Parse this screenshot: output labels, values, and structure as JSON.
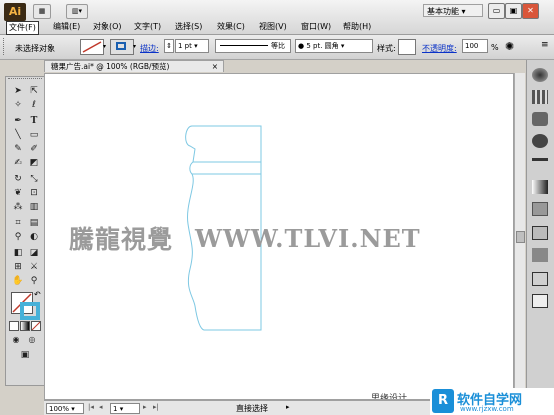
{
  "app": {
    "logo": "Ai",
    "workspace": "基本功能"
  },
  "window_controls": {
    "minimize": "▭",
    "restore": "▣",
    "close": "✕"
  },
  "menu": [
    "文件(F)",
    "编辑(E)",
    "对象(O)",
    "文字(T)",
    "选择(S)",
    "效果(C)",
    "视图(V)",
    "窗口(W)",
    "帮助(H)"
  ],
  "control_bar": {
    "selection_label": "未选择对象",
    "stroke_label": "描边:",
    "stroke_weight": "1 pt",
    "profile_label": "等比",
    "brush_label": "5 pt. 圆角",
    "style_label": "样式:",
    "opacity_label": "不透明度:",
    "opacity_value": "100",
    "opacity_unit": "%"
  },
  "document_tab": {
    "title": "糖果广告.ai* @ 100% (RGB/预览)",
    "close": "×"
  },
  "status_bar": {
    "zoom": "100%",
    "page": "1",
    "tool": "直接选择"
  },
  "watermarks": {
    "main_cn": "騰龍視覺",
    "main_en": "WWW.TLVI.NET",
    "corner_text": "思缘设计",
    "site_name": "软件自学网",
    "site_url": "www.rjzxw.com"
  },
  "colors": {
    "stroke_path": "#7ec8e3",
    "accent_stroke_swatch": "#c0392b",
    "tool_stroke_cyan": "#46b1d8"
  },
  "icons": {
    "tools": [
      "selection-icon",
      "direct-selection-icon",
      "magic-wand-icon",
      "lasso-icon",
      "pen-icon",
      "type-icon",
      "line-icon",
      "rectangle-icon",
      "paintbrush-icon",
      "pencil-icon",
      "blob-brush-icon",
      "eraser-icon",
      "rotate-icon",
      "scale-icon",
      "warp-icon",
      "free-transform-icon",
      "symbol-sprayer-icon",
      "graph-icon",
      "mesh-icon",
      "gradient-icon",
      "eyedropper-icon",
      "blend-icon",
      "live-paint-icon",
      "live-paint-select-icon",
      "artboard-icon",
      "slice-icon",
      "hand-icon",
      "zoom-icon"
    ]
  }
}
